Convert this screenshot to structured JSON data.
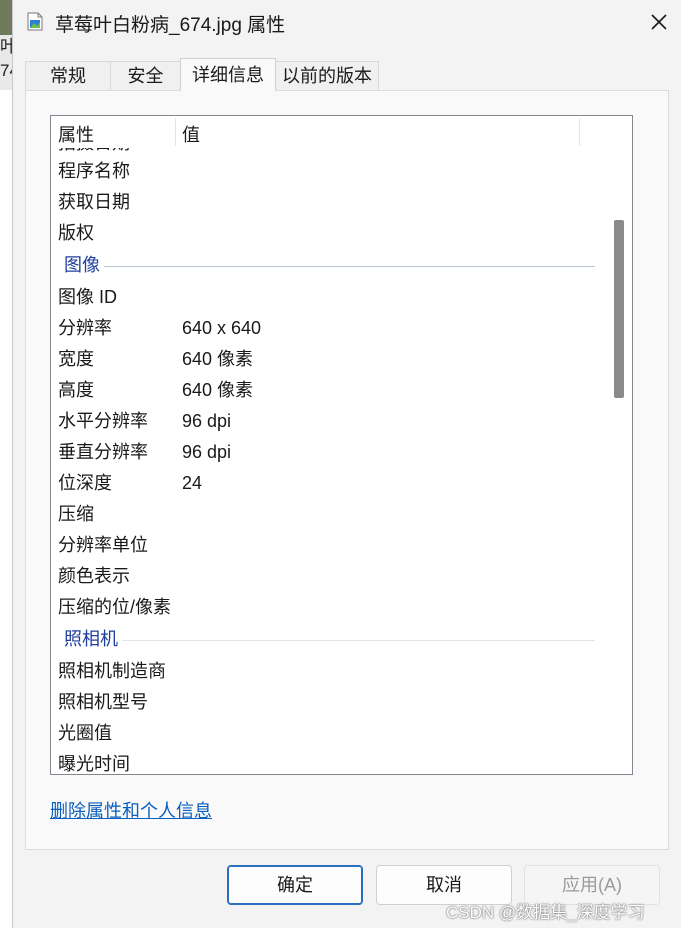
{
  "window": {
    "title": "草莓叶白粉病_674.jpg 属性",
    "background_fragment": "叶\n74"
  },
  "tabs": [
    {
      "label": "常规"
    },
    {
      "label": "安全"
    },
    {
      "label": "详细信息",
      "active": true
    },
    {
      "label": "以前的版本"
    }
  ],
  "details": {
    "col_property": "属性",
    "col_value": "值",
    "rows": [
      {
        "type": "row",
        "key": "拍摄日期",
        "value": ""
      },
      {
        "type": "row",
        "key": "程序名称",
        "value": ""
      },
      {
        "type": "row",
        "key": "获取日期",
        "value": ""
      },
      {
        "type": "row",
        "key": "版权",
        "value": ""
      },
      {
        "type": "group",
        "key": "图像"
      },
      {
        "type": "row",
        "key": "图像 ID",
        "value": ""
      },
      {
        "type": "row",
        "key": "分辨率",
        "value": "640 x 640"
      },
      {
        "type": "row",
        "key": "宽度",
        "value": "640 像素"
      },
      {
        "type": "row",
        "key": "高度",
        "value": "640 像素"
      },
      {
        "type": "row",
        "key": "水平分辨率",
        "value": "96 dpi"
      },
      {
        "type": "row",
        "key": "垂直分辨率",
        "value": "96 dpi"
      },
      {
        "type": "row",
        "key": "位深度",
        "value": "24"
      },
      {
        "type": "row",
        "key": "压缩",
        "value": ""
      },
      {
        "type": "row",
        "key": "分辨率单位",
        "value": ""
      },
      {
        "type": "row",
        "key": "颜色表示",
        "value": ""
      },
      {
        "type": "row",
        "key": "压缩的位/像素",
        "value": ""
      },
      {
        "type": "group",
        "key": "照相机"
      },
      {
        "type": "row",
        "key": "照相机制造商",
        "value": ""
      },
      {
        "type": "row",
        "key": "照相机型号",
        "value": ""
      },
      {
        "type": "row",
        "key": "光圈值",
        "value": ""
      },
      {
        "type": "row",
        "key": "曝光时间",
        "value": ""
      }
    ]
  },
  "remove_link": "删除属性和个人信息",
  "buttons": {
    "ok": "确定",
    "cancel": "取消",
    "apply": "应用(A)"
  },
  "watermark": "CSDN @数据集_深度学习",
  "colors": {
    "group_text": "#1e3e9e",
    "link": "#0a5fc0",
    "primary_border": "#2a6ec0"
  }
}
